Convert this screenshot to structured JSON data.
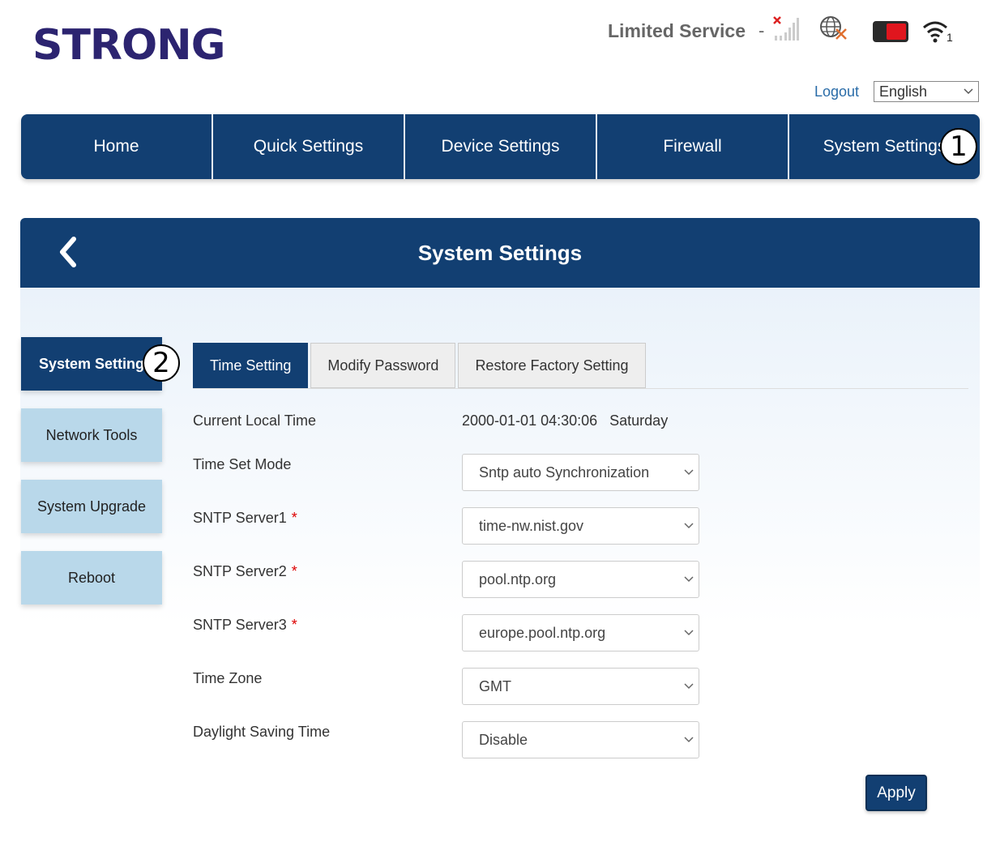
{
  "brand": {
    "logo_text": "STRONG"
  },
  "status": {
    "text": "Limited Service",
    "separator": "-",
    "wifi_count": "1"
  },
  "toplinks": {
    "logout": "Logout",
    "language": "English"
  },
  "nav": [
    {
      "label": "Home"
    },
    {
      "label": "Quick Settings"
    },
    {
      "label": "Device Settings"
    },
    {
      "label": "Firewall"
    },
    {
      "label": "System Settings"
    }
  ],
  "markers": {
    "one": "1",
    "two": "2"
  },
  "page": {
    "title": "System Settings"
  },
  "sidebar": [
    {
      "label": "System Setting"
    },
    {
      "label": "Network Tools"
    },
    {
      "label": "System Upgrade"
    },
    {
      "label": "Reboot"
    }
  ],
  "tabs": [
    {
      "label": "Time Setting"
    },
    {
      "label": "Modify Password"
    },
    {
      "label": "Restore Factory Setting"
    }
  ],
  "form": {
    "current_local_time": {
      "label": "Current Local Time",
      "value": "2000-01-01 04:30:06   Saturday"
    },
    "time_set_mode": {
      "label": "Time Set Mode",
      "value": "Sntp auto Synchronization"
    },
    "sntp1": {
      "label": "SNTP Server1",
      "value": "time-nw.nist.gov"
    },
    "sntp2": {
      "label": "SNTP Server2",
      "value": "pool.ntp.org"
    },
    "sntp3": {
      "label": "SNTP Server3",
      "value": "europe.pool.ntp.org"
    },
    "time_zone": {
      "label": "Time Zone",
      "value": "GMT"
    },
    "dst": {
      "label": "Daylight Saving Time",
      "value": "Disable"
    },
    "required_mark": "*"
  },
  "apply_label": "Apply",
  "colors": {
    "primary": "#123f72",
    "sidebar_inactive": "#b9d8ea",
    "link": "#2a6ca8",
    "required": "#dd0000",
    "battery": "#e0161e"
  }
}
